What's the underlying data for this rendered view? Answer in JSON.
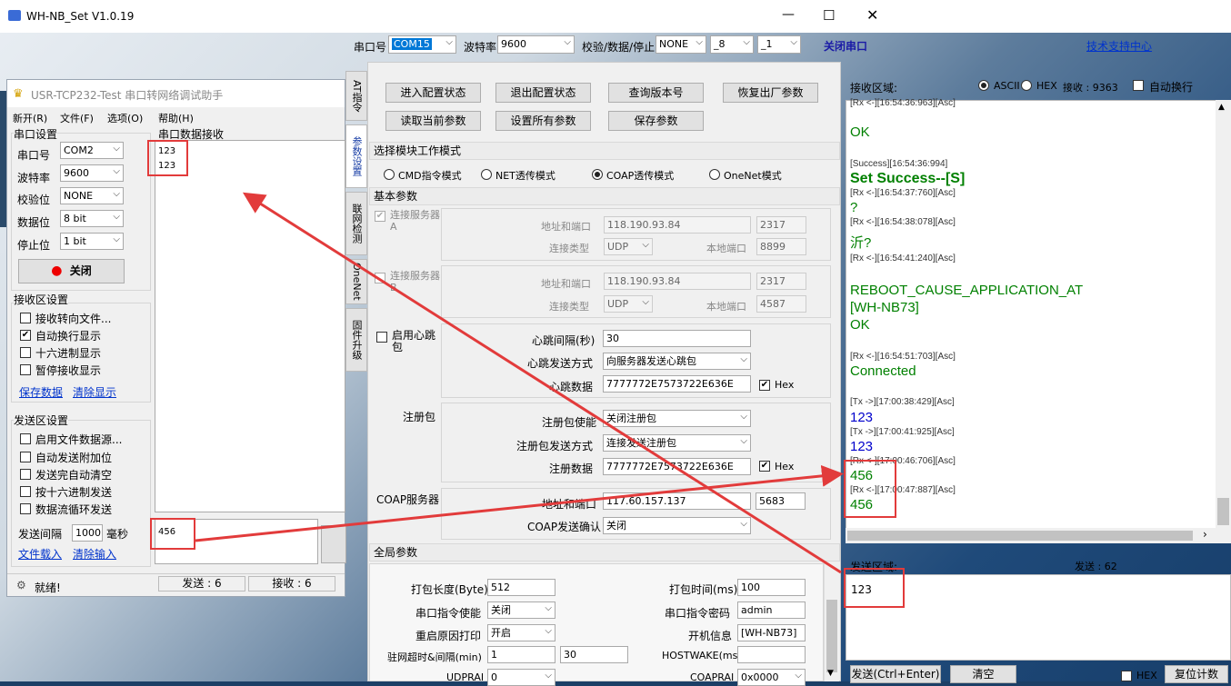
{
  "w1": {
    "title": "USR-TCP232-Test 串口转网络调试助手",
    "menu": [
      "新开(R)",
      "文件(F)",
      "选项(O)",
      "帮助(H)"
    ],
    "serial_group": "串口设置",
    "port_label": "串口号",
    "port": "COM2",
    "baud_label": "波特率",
    "baud": "9600",
    "parity_label": "校验位",
    "parity": "NONE",
    "data_label": "数据位",
    "data": "8 bit",
    "stop_label": "停止位",
    "stop": "1 bit",
    "close_btn": "关闭",
    "recv_group": "接收区设置",
    "recv_opts": [
      "接收转向文件...",
      "自动换行显示",
      "十六进制显示",
      "暂停接收显示"
    ],
    "save_data": "保存数据",
    "clear_display": "清除显示",
    "send_group": "发送区设置",
    "send_opts": [
      "启用文件数据源...",
      "自动发送附加位",
      "发送完自动清空",
      "按十六进制发送",
      "数据流循环发送"
    ],
    "interval_label": "发送间隔",
    "interval": "1000",
    "interval_unit": "毫秒",
    "file_load": "文件载入",
    "clear_input": "清除输入",
    "recv_area_title": "串口数据接收",
    "recv_lines": [
      "123",
      "123"
    ],
    "send_text": "456",
    "status": "就绪!",
    "sent": "发送 : 6",
    "recvd": "接收 : 6"
  },
  "w2": {
    "title": "WH-NB_Set V1.0.19",
    "port_label": "串口号",
    "port": "COM15",
    "baud_label": "波特率",
    "baud": "9600",
    "cfg_label": "校验/数据/停止",
    "parity": "NONE",
    "databits": "_8",
    "stopbits": "_1",
    "close_port": "关闭串口",
    "support": "技术支持中心",
    "vtabs": [
      "AT指令",
      "参数设置",
      "联网检测",
      "OneNet",
      "固件升级"
    ],
    "btns": [
      "进入配置状态",
      "退出配置状态",
      "查询版本号",
      "恢复出厂参数",
      "读取当前参数",
      "设置所有参数",
      "保存参数"
    ],
    "mode_section": "选择模块工作模式",
    "modes": [
      "CMD指令模式",
      "NET透传模式",
      "COAP透传模式",
      "OneNet模式"
    ],
    "basic_section": "基本参数",
    "srvA": "连接服务器A",
    "srvB": "连接服务器B",
    "addr_label": "地址和端口",
    "conn_type_label": "连接类型",
    "local_port_label": "本地端口",
    "a_ip": "118.190.93.84",
    "a_port": "2317",
    "a_type": "UDP",
    "a_local": "8899",
    "b_ip": "118.190.93.84",
    "b_port": "2317",
    "b_type": "UDP",
    "b_local": "4587",
    "hb_enable": "启用心跳包",
    "hb_int_label": "心跳间隔(秒)",
    "hb_int": "30",
    "hb_mode_label": "心跳发送方式",
    "hb_mode": "向服务器发送心跳包",
    "hb_data_label": "心跳数据",
    "hb_data": "7777772E7573722E636E",
    "hex": "Hex",
    "reg": "注册包",
    "reg_en_label": "注册包使能",
    "reg_en": "关闭注册包",
    "reg_mode_label": "注册包发送方式",
    "reg_mode": "连接发送注册包",
    "reg_data_label": "注册数据",
    "reg_data": "7777772E7573722E636E",
    "coap": "COAP服务器",
    "coap_addr_label": "地址和端口",
    "coap_ip": "117.60.157.137",
    "coap_port": "5683",
    "coap_ack_label": "COAP发送确认",
    "coap_ack": "关闭",
    "global_section": "全局参数",
    "pk_len_label": "打包长度(Byte)",
    "pk_len": "512",
    "pk_time_label": "打包时间(ms)",
    "pk_time": "100",
    "cmd_en_label": "串口指令使能",
    "cmd_en": "关闭",
    "cmd_pwd_label": "串口指令密码",
    "cmd_pwd": "admin",
    "reboot_label": "重启原因打印",
    "reboot": "开启",
    "boot_label": "开机信息",
    "boot": "[WH-NB73]",
    "idle_label": "驻网超时&间隔(min)",
    "idle1": "1",
    "idle2": "30",
    "hostwake_label": "HOSTWAKE(ms)",
    "hostwake": "",
    "udprai_label": "UDPRAI",
    "udprai": "0",
    "coaprai_label": "COAPRAI",
    "coaprai": "0x0000",
    "recv_area": "接收区域:",
    "ascii": "ASCII",
    "hex_r": "HEX",
    "recv_count": "接收 : 9363",
    "auto_wrap": "自动换行",
    "log": [
      "[Rx <-][16:54:36:963][Asc]",
      "OK",
      "[Success][16:54:36:994]",
      "Set Success--[S]",
      "[Rx <-][16:54:37:760][Asc]",
      "?",
      "[Rx <-][16:54:38:078][Asc]",
      "沂?",
      "[Rx <-][16:54:41:240][Asc]",
      "REBOOT_CAUSE_APPLICATION_AT",
      "[WH-NB73]",
      "OK",
      "[Rx <-][16:54:51:703][Asc]",
      "Connected",
      "[Tx ->][17:00:38:429][Asc]",
      "123",
      "[Tx ->][17:00:41:925][Asc]",
      "123",
      "[Rx <-][17:00:46:706][Asc]",
      "456",
      "[Rx <-][17:00:47:887][Asc]",
      "456"
    ],
    "send_area": "发送区域:",
    "send_count": "发送 : 62",
    "send_text": "123",
    "send_btn": "发送(Ctrl+Enter)",
    "clear_btn": "清空",
    "hex_s": "HEX",
    "reset_btn": "复位计数"
  }
}
